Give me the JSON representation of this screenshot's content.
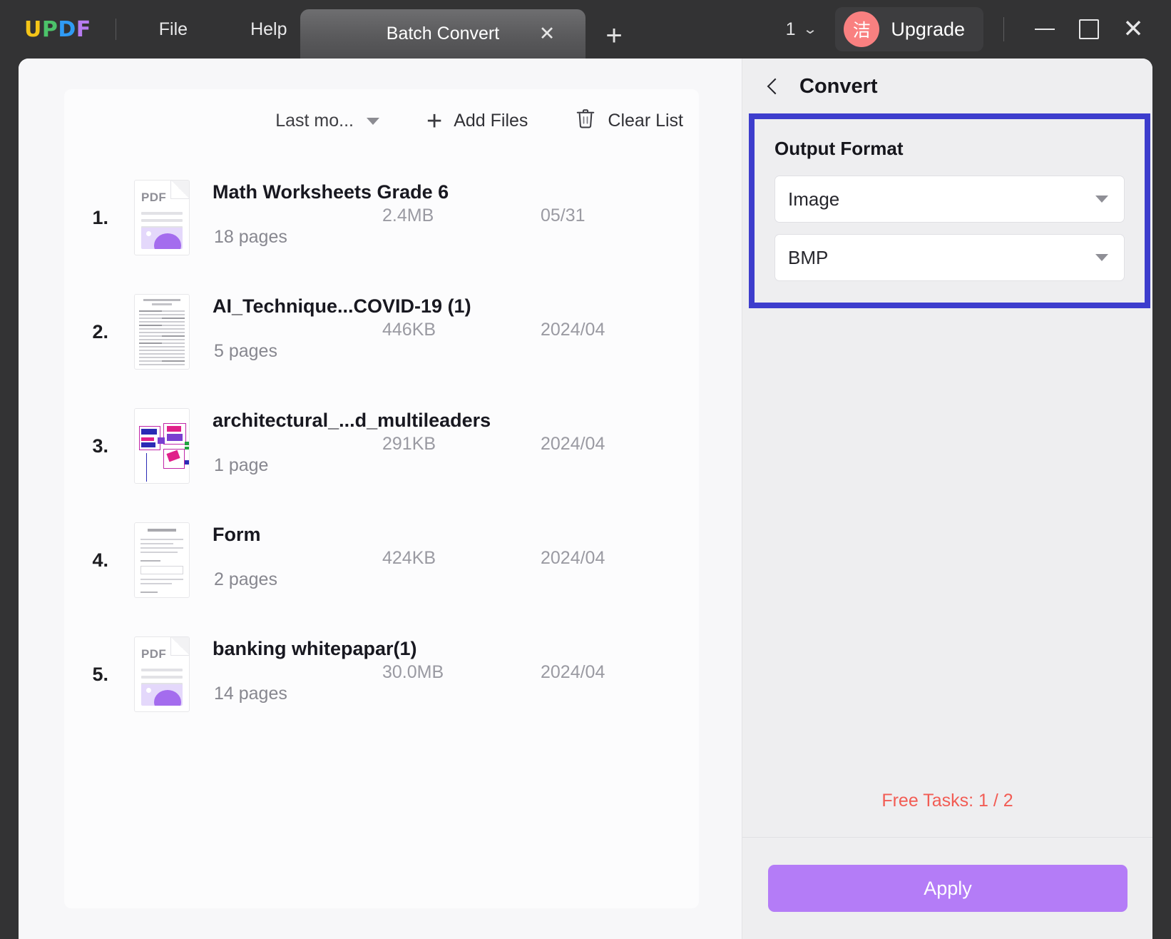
{
  "titlebar": {
    "logo_letters": [
      "U",
      "P",
      "D",
      "F"
    ],
    "menu": [
      {
        "label": "File",
        "name": "menu-file"
      },
      {
        "label": "Help",
        "name": "menu-help"
      }
    ],
    "tab": {
      "label": "Batch Convert",
      "close_icon": "close-icon",
      "add_icon": "plus-icon"
    },
    "page_counter": {
      "value": "1",
      "caret_icon": "chevron-down-icon"
    },
    "upgrade": {
      "label": "Upgrade",
      "avatar_text": "洁",
      "avatar_color": "#F98080"
    },
    "window_controls": {
      "minimize": "minimize-icon",
      "maximize": "maximize-icon",
      "close": "close-icon"
    }
  },
  "toolbar": {
    "sort_label": "Last mo...",
    "add_files_label": "Add Files",
    "clear_list_label": "Clear List"
  },
  "files": [
    {
      "index": "1.",
      "name": "Math Worksheets Grade 6",
      "pages": "18 pages",
      "size": "2.4MB",
      "date": "05/31",
      "thumb": "pdf"
    },
    {
      "index": "2.",
      "name": "AI_Technique...COVID-19 (1)",
      "pages": "5 pages",
      "size": "446KB",
      "date": "2024/04",
      "thumb": "paper"
    },
    {
      "index": "3.",
      "name": "architectural_...d_multileaders",
      "pages": "1 page",
      "size": "291KB",
      "date": "2024/04",
      "thumb": "cad"
    },
    {
      "index": "4.",
      "name": "Form",
      "pages": "2 pages",
      "size": "424KB",
      "date": "2024/04",
      "thumb": "form"
    },
    {
      "index": "5.",
      "name": "banking whitepapar(1)",
      "pages": "14 pages",
      "size": "30.0MB",
      "date": "2024/04",
      "thumb": "pdf"
    }
  ],
  "right_panel": {
    "title": "Convert",
    "back_icon": "chevron-left-icon",
    "output_format": {
      "label": "Output Format",
      "type_value": "Image",
      "subtype_value": "BMP",
      "highlight_color": "#3D3DCD"
    },
    "free_tasks": "Free Tasks: 1 / 2",
    "apply_label": "Apply",
    "apply_color": "#B47CF7",
    "free_tasks_color": "#F25C54"
  }
}
